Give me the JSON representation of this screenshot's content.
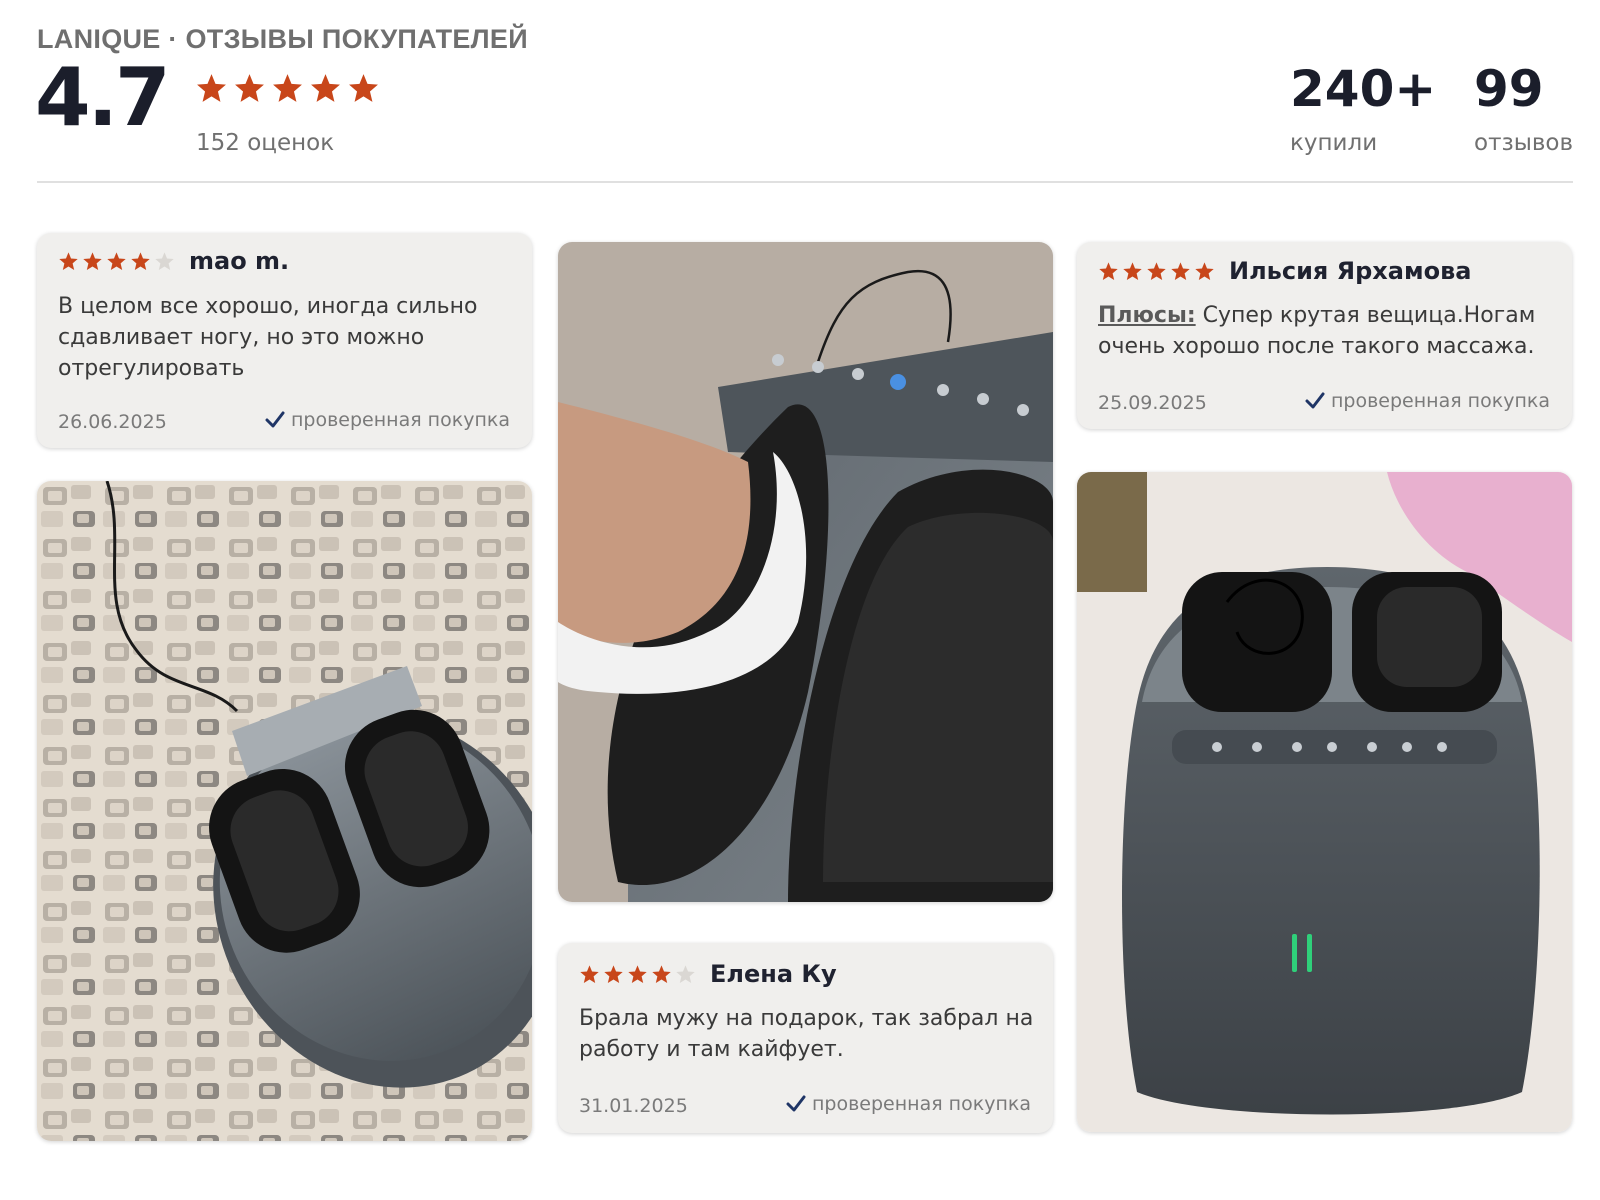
{
  "header": {
    "brand": "LANIQUE · ОТЗЫВЫ ПОКУПАТЕЛЕЙ",
    "rating": "4.7",
    "rating_stars": 5,
    "ratings_count": "152 оценок",
    "bought_value": "240+",
    "bought_label": "купили",
    "reviews_value": "99",
    "reviews_label": "отзывов"
  },
  "colors": {
    "star": "#c8461a",
    "star_empty": "#dad7d3",
    "check": "#1f3566"
  },
  "reviews": [
    {
      "stars": 4,
      "author": "mao m.",
      "text": "В целом все хорошо, иногда сильно сдавливает ногу, но это можно отрегулировать",
      "date": "26.06.2025",
      "verified": "проверенная покупка"
    },
    {
      "stars": 4,
      "author": "Елена Ку",
      "text": "Брала мужу на подарок, так забрал на работу и там кайфует.",
      "date": "31.01.2025",
      "verified": "проверенная покупка"
    },
    {
      "stars": 5,
      "author": "Ильсия Ярхамова",
      "pros_label": "Плюсы:",
      "text": "Супер крутая вещица.Ногам очень хорошо после такого массажа.",
      "date": "25.09.2025",
      "verified": "проверенная покупка"
    }
  ],
  "photos": [
    {
      "alt": "foot-massager-on-carpet-photo"
    },
    {
      "alt": "foot-in-massager-photo"
    },
    {
      "alt": "massager-with-cable-photo"
    }
  ]
}
